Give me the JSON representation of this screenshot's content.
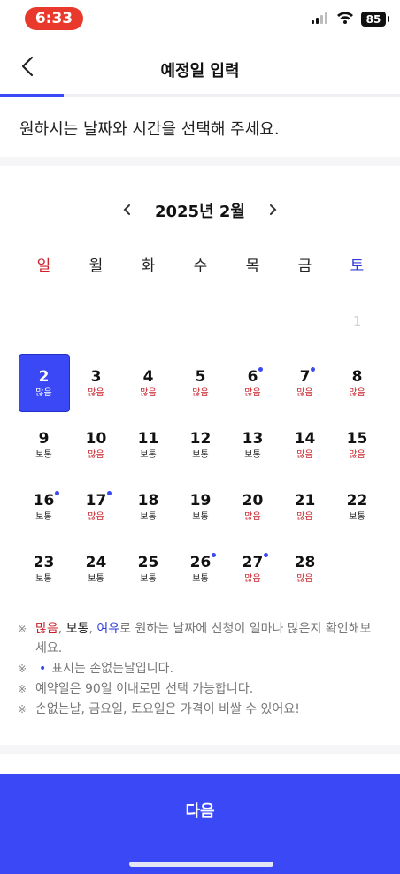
{
  "status_bar": {
    "time": "6:33",
    "battery": "85",
    "icons": [
      "signal-icon",
      "wifi-icon",
      "battery-icon"
    ]
  },
  "header": {
    "title": "예정일 입력",
    "back_icon": "chevron-left-icon",
    "progress": 0.16
  },
  "instruction": "원하시는 날짜와 시간을 선택해 주세요.",
  "calendar": {
    "month_label": "2025년 2월",
    "prev_icon": "chevron-left-icon",
    "next_icon": "chevron-right-icon",
    "weekdays": [
      "일",
      "월",
      "화",
      "수",
      "목",
      "금",
      "토"
    ],
    "leading_empty": 6,
    "days": [
      {
        "num": "1",
        "status": "",
        "dot": false,
        "disabled": true,
        "selected": false,
        "level": ""
      },
      {
        "num": "2",
        "status": "많음",
        "dot": false,
        "disabled": false,
        "selected": true,
        "level": "busy"
      },
      {
        "num": "3",
        "status": "많음",
        "dot": false,
        "disabled": false,
        "selected": false,
        "level": "busy"
      },
      {
        "num": "4",
        "status": "많음",
        "dot": false,
        "disabled": false,
        "selected": false,
        "level": "busy"
      },
      {
        "num": "5",
        "status": "많음",
        "dot": false,
        "disabled": false,
        "selected": false,
        "level": "busy"
      },
      {
        "num": "6",
        "status": "많음",
        "dot": true,
        "disabled": false,
        "selected": false,
        "level": "busy"
      },
      {
        "num": "7",
        "status": "많음",
        "dot": true,
        "disabled": false,
        "selected": false,
        "level": "busy"
      },
      {
        "num": "8",
        "status": "많음",
        "dot": false,
        "disabled": false,
        "selected": false,
        "level": "busy"
      },
      {
        "num": "9",
        "status": "보통",
        "dot": false,
        "disabled": false,
        "selected": false,
        "level": "normal"
      },
      {
        "num": "10",
        "status": "많음",
        "dot": false,
        "disabled": false,
        "selected": false,
        "level": "busy"
      },
      {
        "num": "11",
        "status": "보통",
        "dot": false,
        "disabled": false,
        "selected": false,
        "level": "normal"
      },
      {
        "num": "12",
        "status": "보통",
        "dot": false,
        "disabled": false,
        "selected": false,
        "level": "normal"
      },
      {
        "num": "13",
        "status": "보통",
        "dot": false,
        "disabled": false,
        "selected": false,
        "level": "normal"
      },
      {
        "num": "14",
        "status": "많음",
        "dot": false,
        "disabled": false,
        "selected": false,
        "level": "busy"
      },
      {
        "num": "15",
        "status": "많음",
        "dot": false,
        "disabled": false,
        "selected": false,
        "level": "busy"
      },
      {
        "num": "16",
        "status": "보통",
        "dot": true,
        "disabled": false,
        "selected": false,
        "level": "normal"
      },
      {
        "num": "17",
        "status": "많음",
        "dot": true,
        "disabled": false,
        "selected": false,
        "level": "busy"
      },
      {
        "num": "18",
        "status": "보통",
        "dot": false,
        "disabled": false,
        "selected": false,
        "level": "normal"
      },
      {
        "num": "19",
        "status": "보통",
        "dot": false,
        "disabled": false,
        "selected": false,
        "level": "normal"
      },
      {
        "num": "20",
        "status": "많음",
        "dot": false,
        "disabled": false,
        "selected": false,
        "level": "busy"
      },
      {
        "num": "21",
        "status": "많음",
        "dot": false,
        "disabled": false,
        "selected": false,
        "level": "busy"
      },
      {
        "num": "22",
        "status": "보통",
        "dot": false,
        "disabled": false,
        "selected": false,
        "level": "normal"
      },
      {
        "num": "23",
        "status": "보통",
        "dot": false,
        "disabled": false,
        "selected": false,
        "level": "normal"
      },
      {
        "num": "24",
        "status": "보통",
        "dot": false,
        "disabled": false,
        "selected": false,
        "level": "normal"
      },
      {
        "num": "25",
        "status": "보통",
        "dot": false,
        "disabled": false,
        "selected": false,
        "level": "normal"
      },
      {
        "num": "26",
        "status": "보통",
        "dot": true,
        "disabled": false,
        "selected": false,
        "level": "normal"
      },
      {
        "num": "27",
        "status": "많음",
        "dot": true,
        "disabled": false,
        "selected": false,
        "level": "busy"
      },
      {
        "num": "28",
        "status": "많음",
        "dot": false,
        "disabled": false,
        "selected": false,
        "level": "busy"
      }
    ]
  },
  "notes": {
    "mark": "※",
    "legend": {
      "busy": "많음",
      "sep1": ", ",
      "normal": "보통",
      "sep2": ", ",
      "free": "여유",
      "rest": "로 원하는 날짜에 신청이 얼마나 많은지 확인해보세요."
    },
    "dot_glyph": "•",
    "dot_note": "표시는 손없는날입니다.",
    "note3": "예약일은 90일 이내로만 선택 가능합니다.",
    "note4": "손없는날, 금요일, 토요일은 가격이 비쌀 수 있어요!"
  },
  "footer": {
    "next_label": "다음"
  },
  "colors": {
    "accent": "#3a49f5",
    "busy": "#c8202a",
    "saturday": "#2f3bd8",
    "status_time_pill": "#e8392c"
  }
}
